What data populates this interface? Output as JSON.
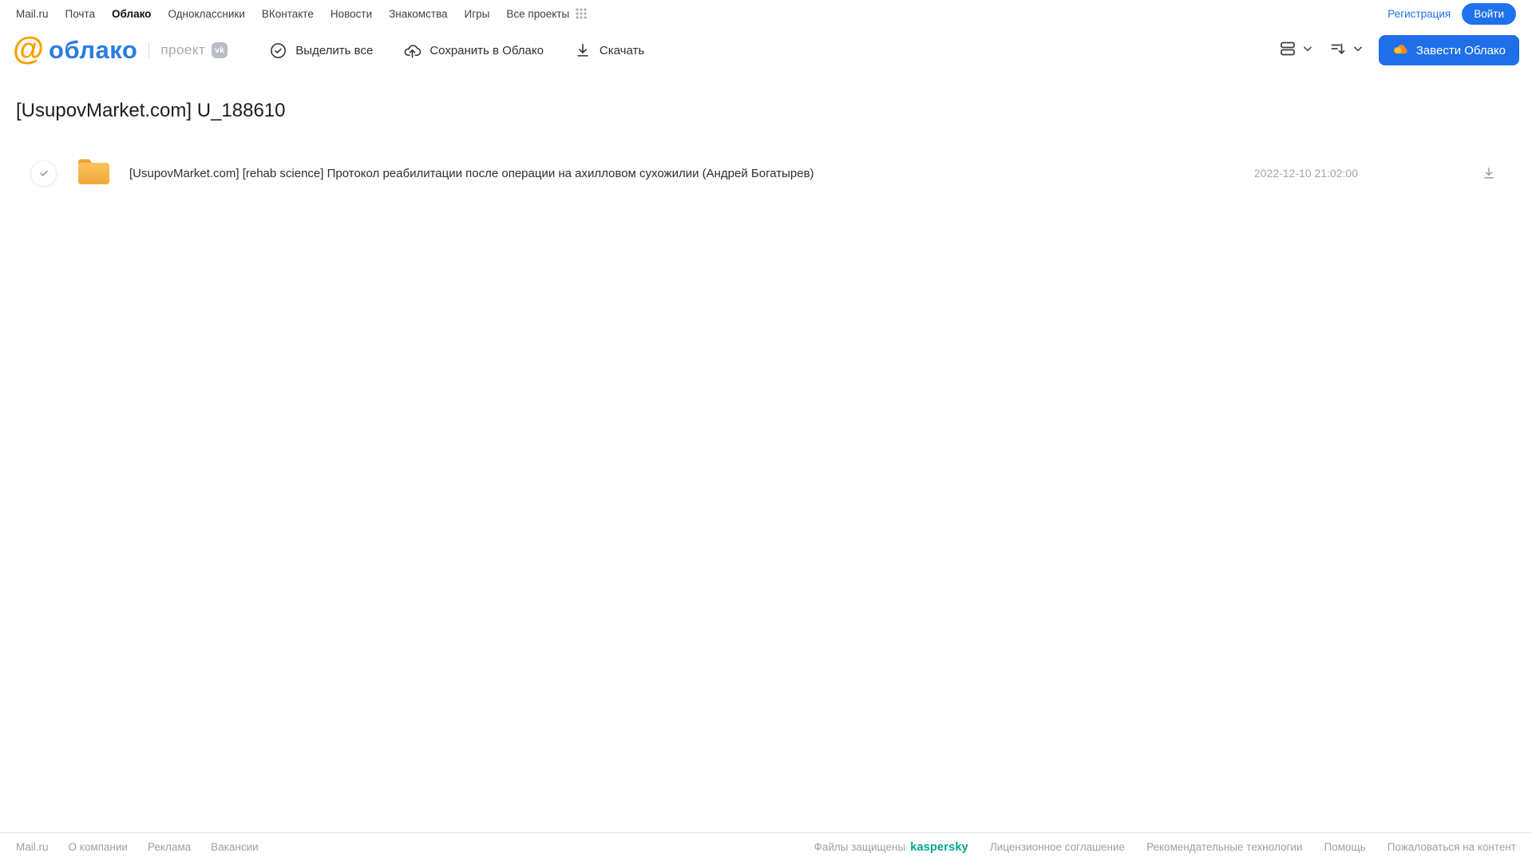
{
  "colors": {
    "accent_blue": "#1f72eb",
    "logo_orange": "#ff9e00",
    "logo_blue": "#2b7ce0",
    "folder_orange": "#f6b545",
    "kaspersky_green": "#00a88e"
  },
  "portal_nav": {
    "items": [
      {
        "label": "Mail.ru",
        "current": false
      },
      {
        "label": "Почта",
        "current": false
      },
      {
        "label": "Облако",
        "current": true
      },
      {
        "label": "Одноклассники",
        "current": false
      },
      {
        "label": "ВКонтакте",
        "current": false
      },
      {
        "label": "Новости",
        "current": false
      },
      {
        "label": "Знакомства",
        "current": false
      },
      {
        "label": "Игры",
        "current": false
      },
      {
        "label": "Все проекты",
        "current": false
      }
    ],
    "registration_label": "Регистрация",
    "login_label": "Войти"
  },
  "header": {
    "logo": {
      "at_symbol": "@",
      "brand": "облако",
      "project_label": "проект",
      "vk_badge": "vk"
    },
    "toolbar": {
      "select_all_label": "Выделить все",
      "save_to_cloud_label": "Сохранить в Облако",
      "download_label": "Скачать"
    },
    "create_cloud_label": "Завести Облако"
  },
  "main": {
    "title": "[UsupovMarket.com] U_188610",
    "files": [
      {
        "name": "[UsupovMarket.com] [rehab science] Протокол реабилитации после операции на ахилловом сухожилии (Андрей Богатырев)",
        "date": "2022-12-10 21:02:00"
      }
    ]
  },
  "footer": {
    "left_links": [
      "Mail.ru",
      "О компании",
      "Реклама",
      "Вакансии"
    ],
    "protected_label": "Файлы защищены",
    "kaspersky_label": "kaspersky",
    "right_links": [
      "Лицензионное соглашение",
      "Рекомендательные технологии",
      "Помощь",
      "Пожаловаться на контент"
    ]
  }
}
